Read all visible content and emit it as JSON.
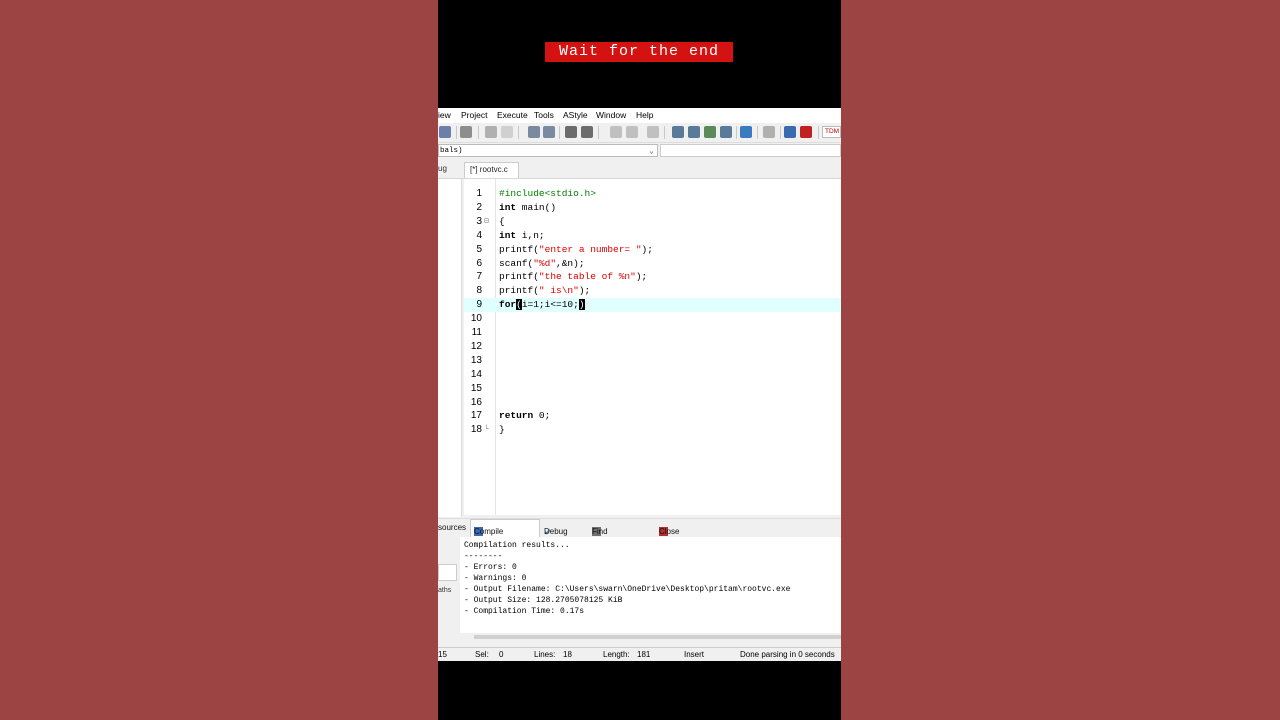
{
  "banner": {
    "text": "Wait for the end"
  },
  "menu": [
    "iew",
    "Project",
    "Execute",
    "Tools",
    "AStyle",
    "Window",
    "Help"
  ],
  "toolbar": {
    "compiler_label": "TDM"
  },
  "scope": {
    "value": "bals)"
  },
  "tabs": {
    "left_partial": "ug",
    "file": "[*] rootvc.c"
  },
  "code_lines": [
    {
      "n": "1",
      "text": "#include<stdio.h>"
    },
    {
      "n": "2",
      "text": "int main()"
    },
    {
      "n": "3",
      "text": "{"
    },
    {
      "n": "4",
      "text": "int i,n;"
    },
    {
      "n": "5",
      "text": "printf(\"enter a number= \");"
    },
    {
      "n": "6",
      "text": "scanf(\"%d\",&n);"
    },
    {
      "n": "7",
      "text": "printf(\"the table of %n\");"
    },
    {
      "n": "8",
      "text": "printf(\" is\\n\");"
    },
    {
      "n": "9",
      "text": "for(i=1;i<=10;)"
    },
    {
      "n": "10",
      "text": ""
    },
    {
      "n": "11",
      "text": ""
    },
    {
      "n": "12",
      "text": ""
    },
    {
      "n": "13",
      "text": ""
    },
    {
      "n": "14",
      "text": ""
    },
    {
      "n": "15",
      "text": ""
    },
    {
      "n": "16",
      "text": ""
    },
    {
      "n": "17",
      "text": "return 0;"
    },
    {
      "n": "18",
      "text": "}"
    }
  ],
  "bottom_tabs": {
    "resources": "sources",
    "compile_log": "Compile Log",
    "debug": "Debug",
    "find_results": "Find Results",
    "close": "Close"
  },
  "log": [
    "Compilation results...",
    "--------",
    "- Errors: 0",
    "- Warnings: 0",
    "- Output Filename: C:\\Users\\swarn\\OneDrive\\Desktop\\pritam\\rootvc.exe",
    "- Output Size: 128.2705078125 KiB",
    "- Compilation Time: 0.17s"
  ],
  "left_stub": {
    "paths": "aths"
  },
  "status": {
    "line_partial": "15",
    "sel_label": "Sel:",
    "sel_value": "0",
    "lines_label": "Lines:",
    "lines_value": "18",
    "length_label": "Length:",
    "length_value": "181",
    "mode": "Insert",
    "message": "Done parsing in 0 seconds"
  }
}
